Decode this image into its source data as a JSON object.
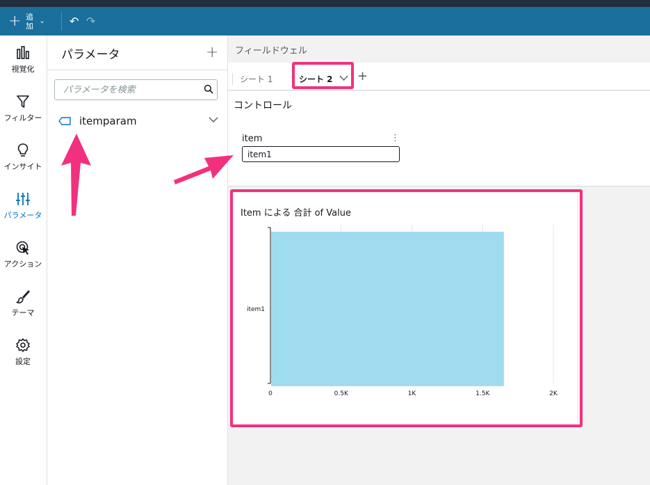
{
  "toolbar": {
    "add_label": "追\n加",
    "add_label_1": "追",
    "add_label_2": "加",
    "undo_icon": "undo-icon",
    "redo_icon": "redo-icon"
  },
  "rail": {
    "items": [
      {
        "label": "視覚化",
        "icon": "bar-chart-icon"
      },
      {
        "label": "フィルター",
        "icon": "filter-icon"
      },
      {
        "label": "インサイト",
        "icon": "lightbulb-icon"
      },
      {
        "label": "パラメータ",
        "icon": "sliders-icon",
        "active": true
      },
      {
        "label": "アクション",
        "icon": "action-cursor-icon"
      },
      {
        "label": "テーマ",
        "icon": "brush-icon"
      },
      {
        "label": "設定",
        "icon": "gear-icon"
      }
    ]
  },
  "panel": {
    "title": "パラメータ",
    "search_placeholder": "パラメータを検索",
    "params": [
      {
        "name": "itemparam"
      }
    ]
  },
  "main": {
    "fieldwell": "フィールドウェル",
    "tabs": [
      {
        "label": "シート 1"
      },
      {
        "label": "シート 2",
        "active": true
      }
    ],
    "controls_title": "コントロール",
    "control": {
      "label": "item",
      "value": "item1"
    }
  },
  "visual": {
    "title": "Item による 合計 of Value"
  },
  "chart_data": {
    "type": "bar",
    "orientation": "horizontal",
    "title": "Item による 合計 of Value",
    "categories": [
      "item1"
    ],
    "values": [
      1650
    ],
    "xlim": [
      0,
      2000
    ],
    "xticks": [
      "0",
      "0.5K",
      "1K",
      "1.5K",
      "2K"
    ],
    "xtick_values": [
      0,
      500,
      1000,
      1500,
      2000
    ],
    "grid": true,
    "bar_color": "#a0dcef"
  },
  "colors": {
    "accent": "#1a6f9c",
    "highlight": "#f2317e",
    "active": "#0073bb"
  }
}
